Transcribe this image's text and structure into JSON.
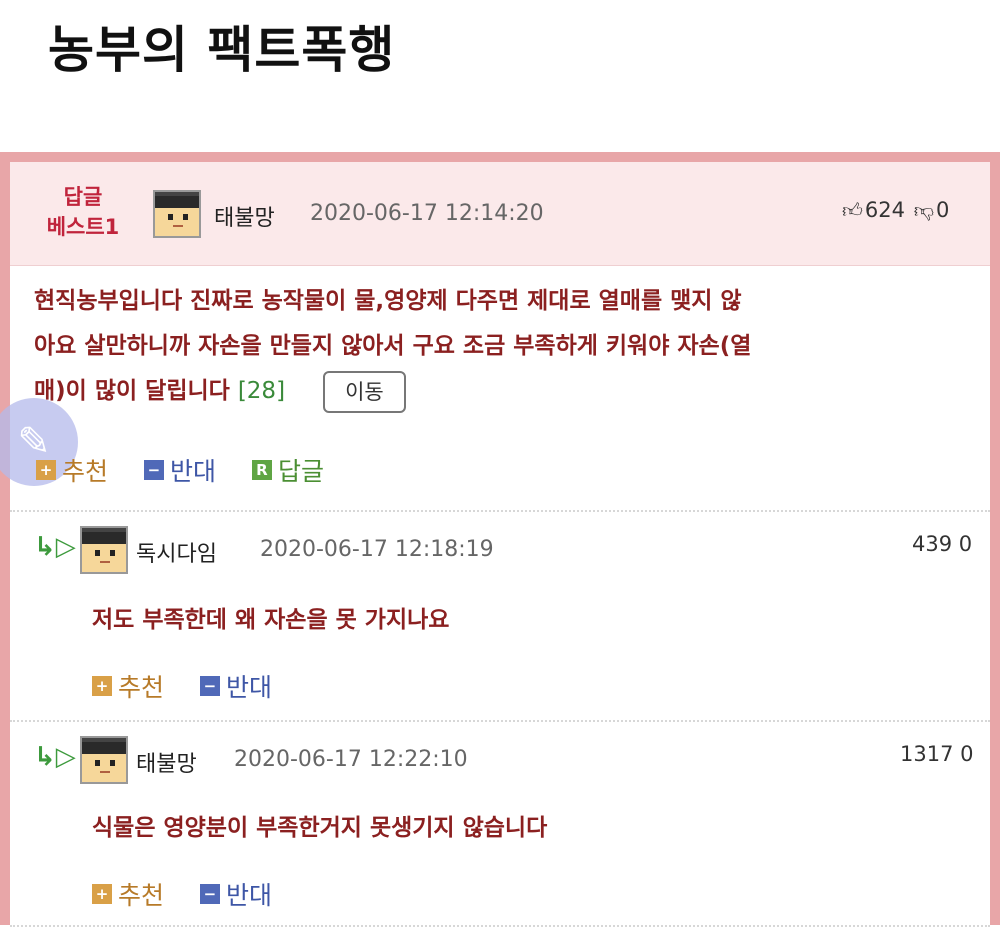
{
  "page": {
    "title": "농부의 팩트폭행"
  },
  "best_comment": {
    "badge_line1": "답글",
    "badge_line2": "베스트1",
    "nickname": "태불망",
    "date": "2020-06-17 12:14:20",
    "likes": "624",
    "dislikes": "0",
    "content_line1": "현직농부입니다 진짜로 농작물이 물,영양제 다주면 제대로 열매를 맺지 않",
    "content_line2": "아요 살만하니까 자손을 만들지 않아서 구요 조금 부족하게 키워야 자손(열",
    "content_line3": "매)이 많이 달립니다",
    "reply_count": "[28]",
    "move_button": "이동",
    "actions": {
      "up": "추천",
      "down": "반대",
      "reply": "답글"
    }
  },
  "replies": [
    {
      "nickname": "독시다임",
      "date": "2020-06-17 12:18:19",
      "likes": "439",
      "dislikes": "0",
      "content": "저도 부족한데 왜 자손을 못 가지나요",
      "actions": {
        "up": "추천",
        "down": "반대"
      }
    },
    {
      "nickname": "태불망",
      "date": "2020-06-17 12:22:10",
      "likes": "1317",
      "dislikes": "0",
      "content": "식물은 영양분이 부족한거지 못생기지 않습니다",
      "actions": {
        "up": "추천",
        "down": "반대"
      }
    }
  ],
  "icons": {
    "like": "thumbs-up-icon",
    "dislike": "thumbs-down-icon",
    "reply_arrow": "reply-arrow-icon",
    "float": "pencil-icon"
  },
  "colors": {
    "board_border": "#e8a6a8",
    "best_header_bg": "#fbe9ea",
    "badge_text": "#c0243c",
    "content_text": "#8b2020",
    "up_icon": "#d9a047",
    "down_icon": "#5069b8",
    "reply_icon": "#5fa544"
  }
}
